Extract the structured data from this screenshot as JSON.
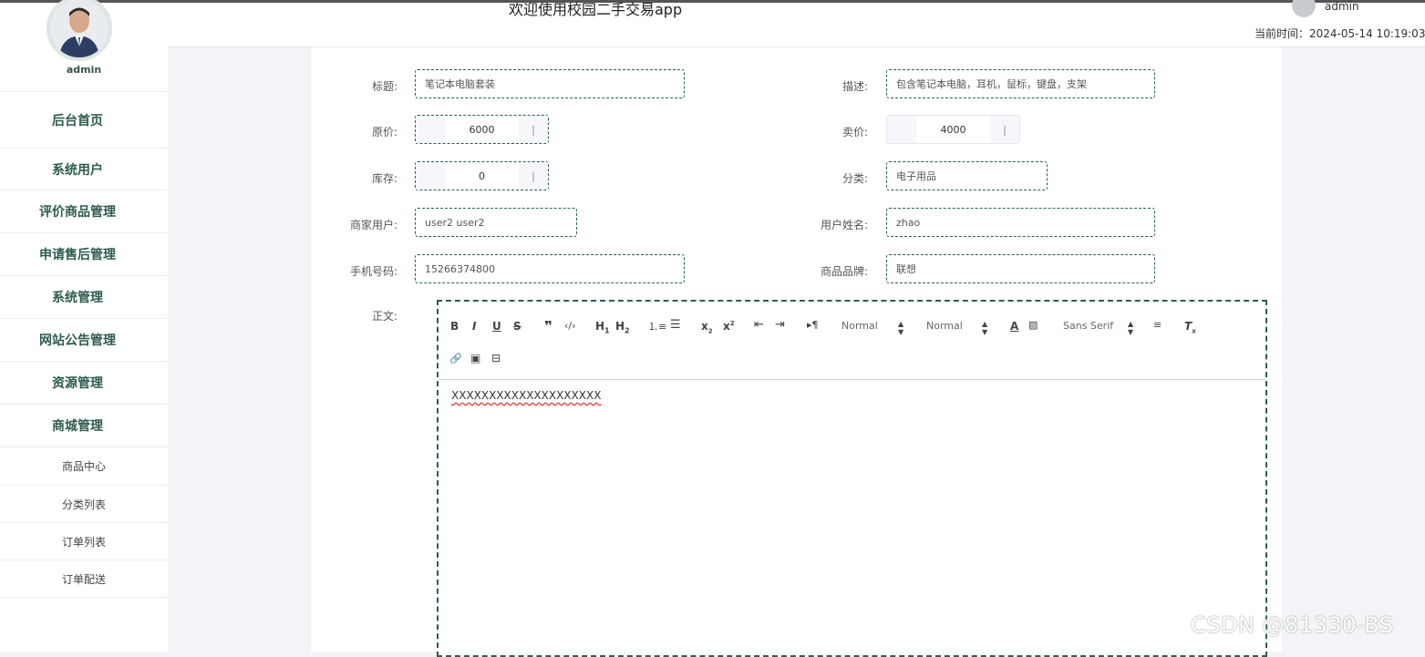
{
  "header": {
    "app_title": "欢迎使用校园二手交易app",
    "user": "admin",
    "time_label": "当前时间：2024-05-14 10:19:03"
  },
  "sidebar": {
    "user": "admin",
    "items": [
      {
        "label": "后台首页"
      },
      {
        "label": "系统用户"
      },
      {
        "label": "评价商品管理"
      },
      {
        "label": "申请售后管理"
      },
      {
        "label": "系统管理"
      },
      {
        "label": "网站公告管理"
      },
      {
        "label": "资源管理"
      },
      {
        "label": "商城管理"
      }
    ],
    "subitems": [
      {
        "label": "商品中心"
      },
      {
        "label": "分类列表"
      },
      {
        "label": "订单列表"
      },
      {
        "label": "订单配送"
      }
    ]
  },
  "form": {
    "title_label": "标题:",
    "title_value": "笔记本电脑套装",
    "desc_label": "描述:",
    "desc_value": "包含笔记本电脑，耳机，鼠标，键盘，支架",
    "orig_price_label": "原价:",
    "orig_price_value": "6000",
    "sell_price_label": "卖价:",
    "sell_price_value": "4000",
    "stock_label": "库存:",
    "stock_value": "0",
    "category_label": "分类:",
    "category_value": "电子用品",
    "merchant_label": "商家用户:",
    "merchant_value": "user2 user2",
    "username_label": "用户姓名:",
    "username_value": "zhao",
    "phone_label": "手机号码:",
    "phone_value": "15266374800",
    "brand_label": "商品品牌:",
    "brand_value": "联想",
    "body_label": "正文:"
  },
  "editor": {
    "header_select": "Normal",
    "size_select": "Normal",
    "font_select": "Sans Serif",
    "content": "XXXXXXXXXXXXXXXXXXXX",
    "toolbar_icons": [
      "bold-icon",
      "italic-icon",
      "underline-icon",
      "strike-icon",
      "blockquote-icon",
      "code-icon",
      "h1-icon",
      "h2-icon",
      "ordered-list-icon",
      "bullet-list-icon",
      "subscript-icon",
      "superscript-icon",
      "outdent-icon",
      "indent-icon",
      "rtl-icon",
      "color-icon",
      "background-icon",
      "align-icon",
      "clean-icon",
      "link-icon",
      "image-icon",
      "video-icon"
    ]
  },
  "watermark": "CSDN @81330-BS",
  "colors": {
    "accent": "#2b5f52",
    "menu_text": "#2d5b50"
  }
}
